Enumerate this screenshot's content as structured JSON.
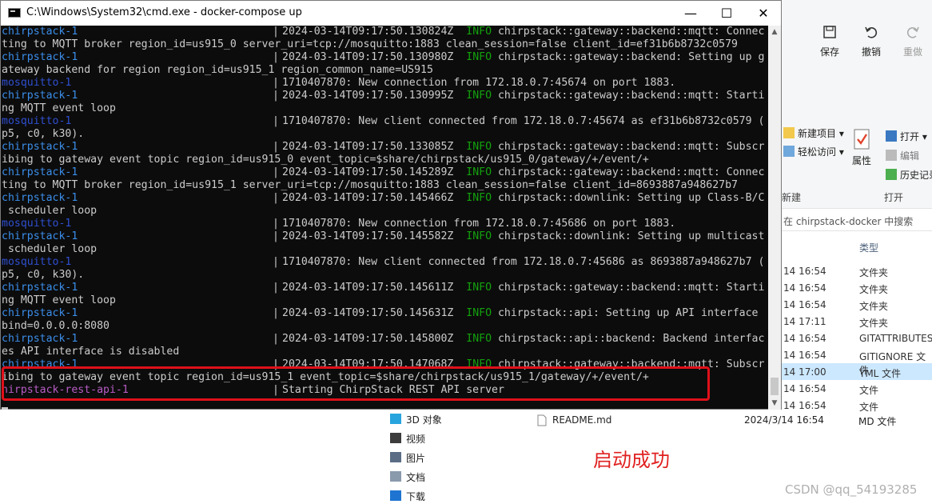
{
  "terminal": {
    "title": "C:\\Windows\\System32\\cmd.exe - docker-compose  up",
    "window_buttons": {
      "minimize": "—",
      "maximize": "☐",
      "close": "✕"
    },
    "lines": [
      {
        "svc": "chirpstack-1",
        "kind": "chirp",
        "msg": "2024-03-14T09:17:50.130824Z  ",
        "info": "INFO",
        "rest": " chirpstack::gateway::backend::mqtt: Connec"
      },
      {
        "cont": "ting to MQTT broker region_id=us915_0 server_uri=tcp://mosquitto:1883 clean_session=false client_id=ef31b6b8732c0579"
      },
      {
        "svc": "chirpstack-1",
        "kind": "chirp",
        "msg": "2024-03-14T09:17:50.130980Z  ",
        "info": "INFO",
        "rest": " chirpstack::gateway::backend: Setting up g"
      },
      {
        "cont": "ateway backend for region region_id=us915_1 region_common_name=US915"
      },
      {
        "svc": "mosquitto-1",
        "kind": "mos",
        "msg": "1710407870: New connection from 172.18.0.7:45674 on port 1883."
      },
      {
        "svc": "chirpstack-1",
        "kind": "chirp",
        "msg": "2024-03-14T09:17:50.130995Z  ",
        "info": "INFO",
        "rest": " chirpstack::gateway::backend::mqtt: Starti"
      },
      {
        "cont": "ng MQTT event loop"
      },
      {
        "svc": "mosquitto-1",
        "kind": "mos",
        "msg": "1710407870: New client connected from 172.18.0.7:45674 as ef31b6b8732c0579 ("
      },
      {
        "cont": "p5, c0, k30)."
      },
      {
        "svc": "chirpstack-1",
        "kind": "chirp",
        "msg": "2024-03-14T09:17:50.133085Z  ",
        "info": "INFO",
        "rest": " chirpstack::gateway::backend::mqtt: Subscr"
      },
      {
        "cont": "ibing to gateway event topic region_id=us915_0 event_topic=$share/chirpstack/us915_0/gateway/+/event/+"
      },
      {
        "svc": "chirpstack-1",
        "kind": "chirp",
        "msg": "2024-03-14T09:17:50.145289Z  ",
        "info": "INFO",
        "rest": " chirpstack::gateway::backend::mqtt: Connec"
      },
      {
        "cont": "ting to MQTT broker region_id=us915_1 server_uri=tcp://mosquitto:1883 clean_session=false client_id=8693887a948627b7"
      },
      {
        "svc": "chirpstack-1",
        "kind": "chirp",
        "msg": "2024-03-14T09:17:50.145466Z  ",
        "info": "INFO",
        "rest": " chirpstack::downlink: Setting up Class-B/C"
      },
      {
        "cont": " scheduler loop"
      },
      {
        "svc": "mosquitto-1",
        "kind": "mos",
        "msg": "1710407870: New connection from 172.18.0.7:45686 on port 1883."
      },
      {
        "svc": "chirpstack-1",
        "kind": "chirp",
        "msg": "2024-03-14T09:17:50.145582Z  ",
        "info": "INFO",
        "rest": " chirpstack::downlink: Setting up multicast"
      },
      {
        "cont": " scheduler loop"
      },
      {
        "svc": "mosquitto-1",
        "kind": "mos",
        "msg": "1710407870: New client connected from 172.18.0.7:45686 as 8693887a948627b7 ("
      },
      {
        "cont": "p5, c0, k30)."
      },
      {
        "svc": "chirpstack-1",
        "kind": "chirp",
        "msg": "2024-03-14T09:17:50.145611Z  ",
        "info": "INFO",
        "rest": " chirpstack::gateway::backend::mqtt: Starti"
      },
      {
        "cont": "ng MQTT event loop"
      },
      {
        "svc": "chirpstack-1",
        "kind": "chirp",
        "msg": "2024-03-14T09:17:50.145631Z  ",
        "info": "INFO",
        "rest": " chirpstack::api: Setting up API interface "
      },
      {
        "cont": "bind=0.0.0.0:8080"
      },
      {
        "svc": "chirpstack-1",
        "kind": "chirp",
        "msg": "2024-03-14T09:17:50.145800Z  ",
        "info": "INFO",
        "rest": " chirpstack::api::backend: Backend interfac"
      },
      {
        "cont": "es API interface is disabled"
      },
      {
        "svc": "chirpstack-1",
        "kind": "chirp",
        "msg": "2024-03-14T09:17:50.147068Z  ",
        "info": "INFO",
        "rest": " chirpstack::gateway::backend::mqtt: Subscr"
      },
      {
        "cont": "ibing to gateway event topic region_id=us915_1 event_topic=$share/chirpstack/us915_1/gateway/+/event/+"
      },
      {
        "svc": "hirpstack-rest-api-1",
        "kind": "rest",
        "msg": "Starting ChirpStack REST API server"
      }
    ]
  },
  "explorer": {
    "quick_access": {
      "save": "保存",
      "undo": "撤销",
      "redo": "重做"
    },
    "ribbon": {
      "new_item": "新建项目 ▾",
      "easy_access": "轻松访问 ▾",
      "properties": "属性",
      "open": "打开 ▾",
      "edit": "编辑",
      "history": "历史记录",
      "group_new": "新建",
      "group_open": "打开"
    },
    "search_placeholder": "在 chirpstack-docker 中搜索",
    "column_type": "类型",
    "file_rows": [
      {
        "date": "14 16:54",
        "type": "文件夹"
      },
      {
        "date": "14 16:54",
        "type": "文件夹"
      },
      {
        "date": "14 16:54",
        "type": "文件夹"
      },
      {
        "date": "14 17:11",
        "type": "文件夹"
      },
      {
        "date": "14 16:54",
        "type": "GITATTRIBUTES"
      },
      {
        "date": "14 16:54",
        "type": "GITIGNORE 文件"
      },
      {
        "date": "14 17:00",
        "type": "YML 文件"
      },
      {
        "date": "14 16:54",
        "type": "文件"
      },
      {
        "date": "14 16:54",
        "type": "文件"
      }
    ],
    "nav_items": [
      "3D 对象",
      "视频",
      "图片",
      "文档",
      "下载"
    ],
    "readme": {
      "name": "README.md",
      "date": "2024/3/14 16:54",
      "type": "MD 文件"
    }
  },
  "annotation": "启动成功",
  "watermark": "CSDN @qq_54193285"
}
